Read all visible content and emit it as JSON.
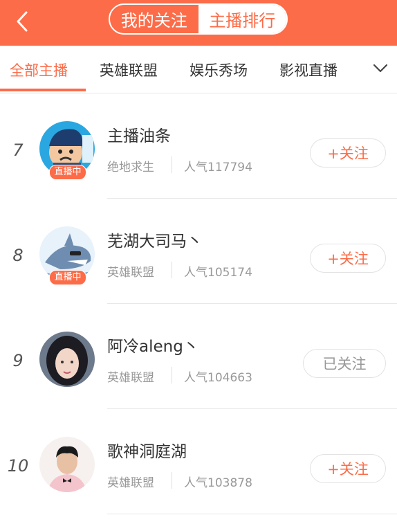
{
  "header": {
    "segments": [
      "我的关注",
      "主播排行"
    ]
  },
  "tabs": [
    "全部主播",
    "英雄联盟",
    "娱乐秀场",
    "影视直播"
  ],
  "live_label": "直播中",
  "streamers": [
    {
      "rank": "7",
      "name": "主播油条",
      "category": "绝地求生",
      "popularity": "人气117794",
      "follow": "+关注"
    },
    {
      "rank": "8",
      "name": "芜湖大司马丶",
      "category": "英雄联盟",
      "popularity": "人气105174",
      "follow": "+关注"
    },
    {
      "rank": "9",
      "name": "阿冷aleng丶",
      "category": "英雄联盟",
      "popularity": "人气104663",
      "follow": "已关注"
    },
    {
      "rank": "10",
      "name": "歌神洞庭湖",
      "category": "英雄联盟",
      "popularity": "人气103878",
      "follow": "+关注"
    }
  ],
  "colors": {
    "accent": "#fc6c48"
  }
}
